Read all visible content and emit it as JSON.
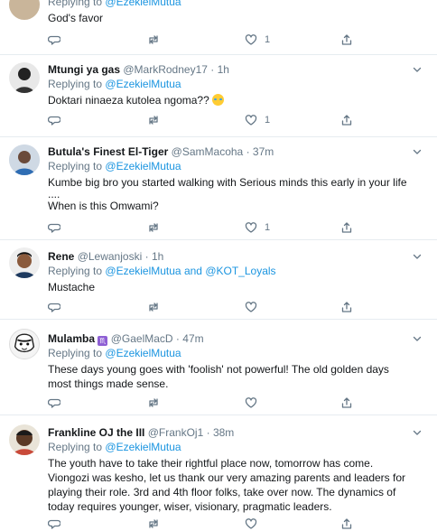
{
  "tweets": [
    {
      "name": "",
      "handle": "",
      "time": "",
      "replying_prefix": "Replying to",
      "replying_to": "@EzekielMutua",
      "replying_and": "",
      "replying_to2": "",
      "lines": [
        "God's favor"
      ],
      "likes": "1"
    },
    {
      "name": "Mtungi ya gas",
      "handle": "@MarkRodney17",
      "time": "1h",
      "replying_prefix": "Replying to",
      "replying_to": "@EzekielMutua",
      "replying_and": "",
      "replying_to2": "",
      "lines": [
        "Doktari ninaeza kutolea ngoma??"
      ],
      "emoji": "face-with-tears-of-joy",
      "likes": "1"
    },
    {
      "name": "Butula's Finest El-Tiger",
      "handle": "@SamMacoha",
      "time": "37m",
      "replying_prefix": "Replying to",
      "replying_to": "@EzekielMutua",
      "replying_and": "",
      "replying_to2": "",
      "lines": [
        "Kumbe big bro you started walking with Serious minds this early in your life",
        "....",
        "When is this Omwami?"
      ],
      "likes": "1"
    },
    {
      "name": "Rene",
      "handle": "@Lewanjoski",
      "time": "1h",
      "replying_prefix": "Replying to",
      "replying_to": "@EzekielMutua",
      "replying_and": "and",
      "replying_to2": "@KOT_Loyals",
      "lines": [
        "Mustache"
      ],
      "likes": ""
    },
    {
      "name": "Mulamba",
      "handle": "@GaelMacD",
      "time": "47m",
      "name_badge": "♏",
      "replying_prefix": "Replying to",
      "replying_to": "@EzekielMutua",
      "replying_and": "",
      "replying_to2": "",
      "lines": [
        "These days young goes with 'foolish' not powerful! The old golden days",
        "most things made sense."
      ],
      "likes": ""
    },
    {
      "name": "Frankline OJ the III",
      "handle": "@FrankOj1",
      "time": "38m",
      "replying_prefix": "Replying to",
      "replying_to": "@EzekielMutua",
      "replying_and": "",
      "replying_to2": "",
      "lines": [
        "The youth have to take their rightful place now, tomorrow has come.",
        "Viongozi was kesho, let us thank our very amazing parents and leaders for",
        "playing their role. 3rd and 4th floor folks, take over now. The dynamics of",
        "today requires younger, wiser, visionary, pragmatic leaders."
      ],
      "likes": ""
    }
  ],
  "colors": {
    "link": "#1b95e0",
    "muted": "#657786",
    "divider": "#e6ecf0"
  },
  "icons": [
    "reply-icon",
    "retweet-icon",
    "like-icon",
    "share-icon",
    "chevron-down-icon"
  ]
}
